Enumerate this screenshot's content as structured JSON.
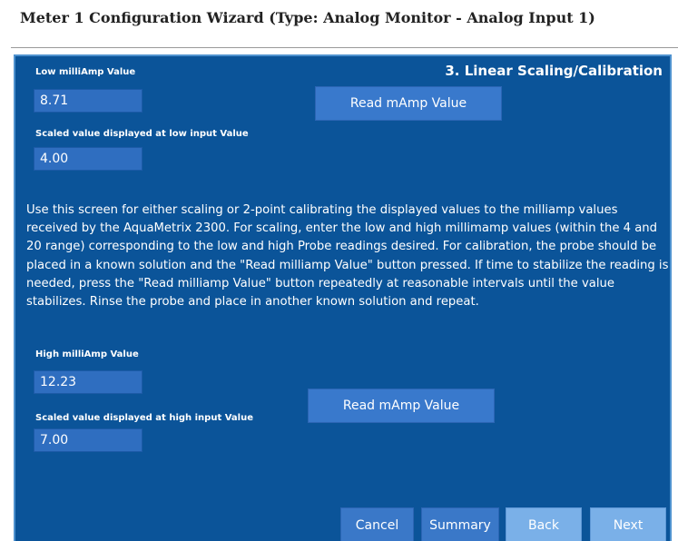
{
  "wizard": {
    "title": "Meter 1 Configuration Wizard (Type: Analog Monitor - Analog Input 1)"
  },
  "panel": {
    "step_title": "3. Linear Scaling/Calibration",
    "low": {
      "milliamp_label": "Low milliAmp Value",
      "milliamp_value": "8.71",
      "read_button": "Read mAmp Value",
      "scaled_label": "Scaled value displayed at low input Value",
      "scaled_value": "4.00"
    },
    "description": "Use this screen for either scaling or 2-point calibrating the displayed values to the milliamp values received by the AquaMetrix 2300. For scaling, enter the low and high millimamp values (within the 4 and 20 range) corresponding to the low and high Probe readings desired. For calibration, the probe should be placed in a known solution and the \"Read milliamp Value\" button pressed. If time to stabilize the reading is needed, press the \"Read milliamp Value\" button repeatedly at reasonable intervals until the value stabilizes. Rinse the probe and place in another known solution and repeat.",
    "high": {
      "milliamp_label": "High milliAmp Value",
      "milliamp_value": "12.23",
      "read_button": "Read mAmp Value",
      "scaled_label": "Scaled value displayed at high input Value",
      "scaled_value": "7.00"
    }
  },
  "buttons": {
    "cancel": "Cancel",
    "summary": "Summary",
    "back": "Back",
    "next": "Next"
  }
}
